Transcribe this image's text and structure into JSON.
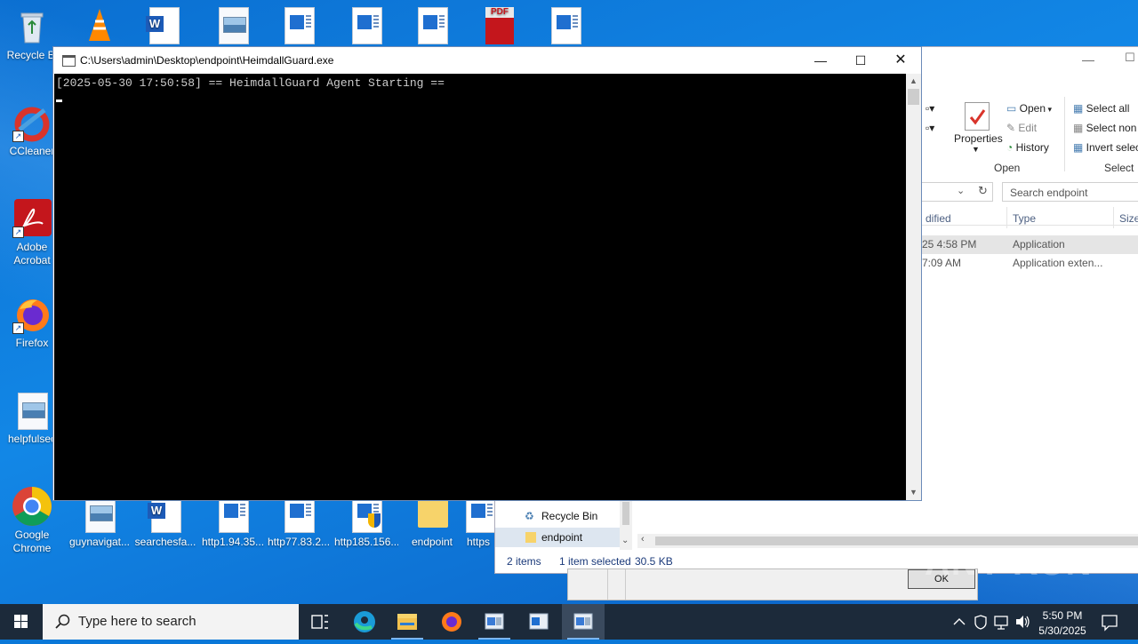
{
  "desktop": {
    "top_icons": [
      "Recycle Bin",
      "",
      "",
      "",
      "",
      "",
      "",
      "",
      ""
    ],
    "left_icons": [
      {
        "label": "Recycle Bi"
      },
      {
        "label": "CCleaner"
      },
      {
        "label": "Adobe Acrobat"
      },
      {
        "label": "Firefox"
      },
      {
        "label": "helpfulsec"
      },
      {
        "label": "Google Chrome"
      }
    ],
    "bottom_icons": [
      {
        "label": "guynavigat..."
      },
      {
        "label": "searchesfa..."
      },
      {
        "label": "http1.94.35..."
      },
      {
        "label": "http77.83.2..."
      },
      {
        "label": "http185.156..."
      },
      {
        "label": "endpoint"
      },
      {
        "label": "https"
      }
    ]
  },
  "console": {
    "title": "C:\\Users\\admin\\Desktop\\endpoint\\HeimdallGuard.exe",
    "output_line": "[2025-05-30 17:50:58] == HeimdallGuard Agent Starting ==",
    "minimize": "—",
    "maximize": "☐",
    "close": "✕"
  },
  "explorer": {
    "ribbon": {
      "properties": "Properties",
      "open": "Open",
      "edit": "Edit",
      "history": "History",
      "select_all": "Select all",
      "select_none": "Select non",
      "invert_selection": "Invert selec",
      "group_open": "Open",
      "group_select": "Select"
    },
    "search_placeholder": "Search endpoint",
    "columns": {
      "modified": "dified",
      "type": "Type",
      "size": "Size"
    },
    "rows": [
      {
        "modified": "25 4:58 PM",
        "type": "Application"
      },
      {
        "modified": "7:09 AM",
        "type": "Application exten..."
      }
    ],
    "nav": [
      {
        "label": "Recycle Bin"
      },
      {
        "label": "endpoint"
      }
    ],
    "status": {
      "items": "2 items",
      "selected": "1 item selected",
      "size": "30.5 KB"
    }
  },
  "dialog": {
    "ok_label": "OK"
  },
  "taskbar": {
    "search_placeholder": "Type here to search",
    "time": "5:50 PM",
    "date": "5/30/2025"
  },
  "watermark": "ANY RUN"
}
